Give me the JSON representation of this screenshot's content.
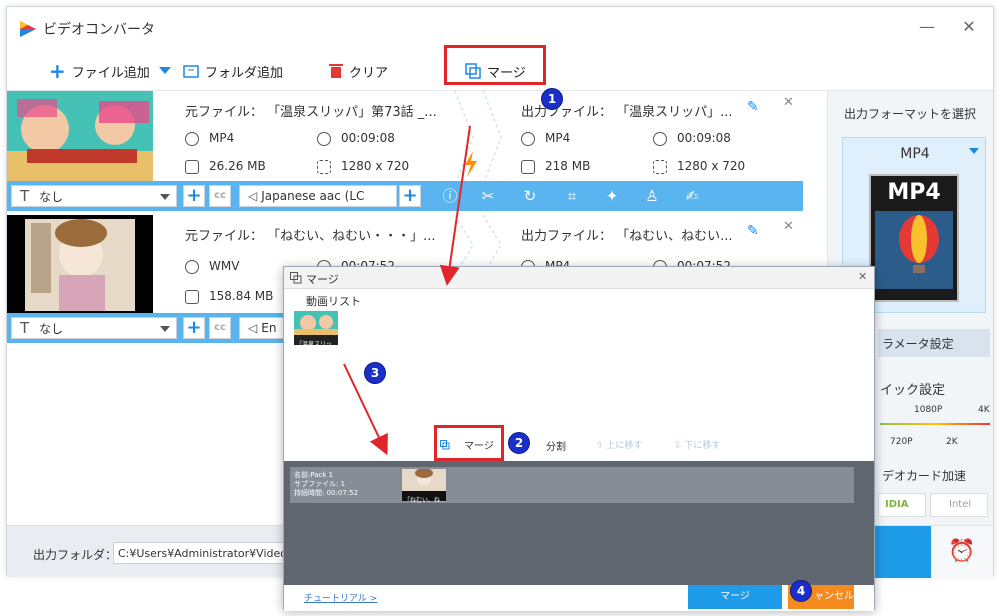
{
  "app": {
    "title": "ビデオコンバータ",
    "minimize": "—",
    "close": "✕"
  },
  "toolbar": {
    "add_file": "ファイル追加",
    "add_folder": "フォルダ追加",
    "clear": "クリア",
    "merge": "マージ"
  },
  "badges": {
    "b1": "1",
    "b2": "2",
    "b3": "3",
    "b4": "4"
  },
  "files": [
    {
      "source_name": "元ファイル： 「温泉スリッパ」第73話 _...",
      "src_format": "MP4",
      "src_duration": "00:09:08",
      "src_size": "26.26 MB",
      "src_resolution": "1280 x 720",
      "output_name": "出力ファイル： 「温泉スリッパ」...",
      "out_format": "MP4",
      "out_duration": "00:09:08",
      "out_size": "218 MB",
      "out_resolution": "1280 x 720",
      "subtitle": "なし",
      "audio": "Japanese aac (LC"
    },
    {
      "source_name": "元ファイル： 「ねむい、ねむい・・・」...",
      "src_format": "WMV",
      "src_duration": "00:07:52",
      "src_size": "158.84 MB",
      "output_name": "出力ファイル： 「ねむい、ねむい...",
      "out_format": "MP4",
      "out_duration": "00:07:52",
      "subtitle": "なし",
      "audio": "En"
    }
  ],
  "right_panel": {
    "format_heading": "出力フォーマットを選択",
    "format_value": "MP4",
    "format_art_text": "MP4",
    "param_settings": "パラメータ設定",
    "param_settings_visible": "ラメータ設定",
    "quality_heading": "イック設定",
    "q_1080": "1080P",
    "q_4k": "4K",
    "q_720": "720P",
    "q_2k": "2K",
    "hw_accel": "デオカード加速",
    "nvidia": "IDIA",
    "intel": "Intel"
  },
  "bottom": {
    "output_folder_label": "出力フォルダ：",
    "output_path": "C:¥Users¥Administrator¥Videos¥Wonder"
  },
  "dialog": {
    "title": "マージ",
    "video_list_label": "動画リスト",
    "thumb_caption": "「温泉スリッ...",
    "merge_btn": "マージ",
    "split_btn": "分割",
    "move_up": "上に移す",
    "move_down": "下に移す",
    "pack_name": "名前:Pack 1",
    "pack_subfiles": "サブファイル: 1",
    "pack_duration": "持続時間: 00:07:52",
    "pack_thumb_caption": "「ねむい、ね...",
    "tutorial": "チュートリアル >",
    "footer_merge": "マージ",
    "footer_cancel": "ャンセル"
  },
  "colors": {
    "accent": "#1e88e5",
    "bar_blue": "#5ab4f0",
    "highlight_red": "#e0262b",
    "badge_blue": "#1a2fc9"
  }
}
